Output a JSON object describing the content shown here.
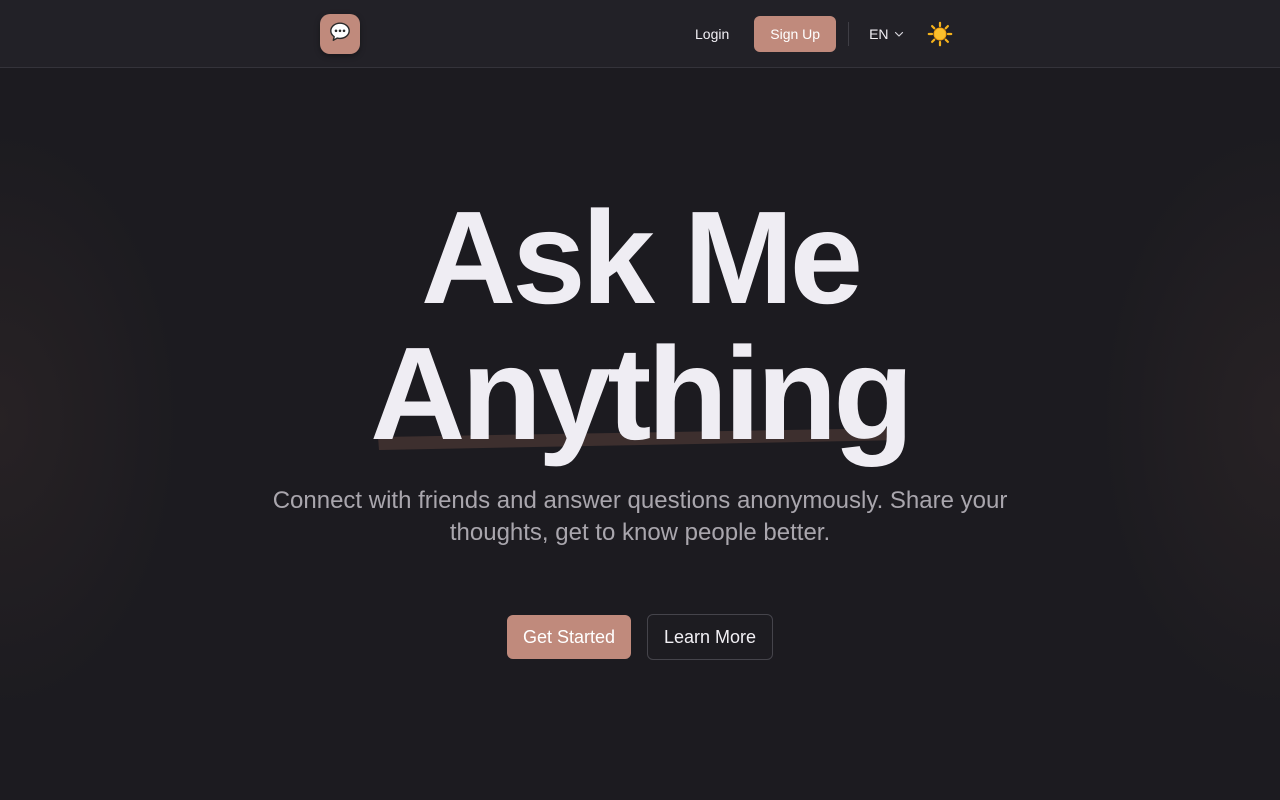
{
  "header": {
    "logo_icon": "chat-bubble-icon",
    "logo_color": "#c08a7c",
    "login_label": "Login",
    "signup_label": "Sign Up",
    "language": "EN",
    "theme_icon": "sun-icon"
  },
  "hero": {
    "title_line1": "Ask Me",
    "title_line2": "Anything",
    "subtitle": "Connect with friends and answer questions anonymously. Share your thoughts, get to know people better.",
    "primary_cta": "Get Started",
    "secondary_cta": "Learn More"
  },
  "colors": {
    "accent": "#c08a7c",
    "background": "#1c1b20",
    "header_background": "#222127"
  }
}
